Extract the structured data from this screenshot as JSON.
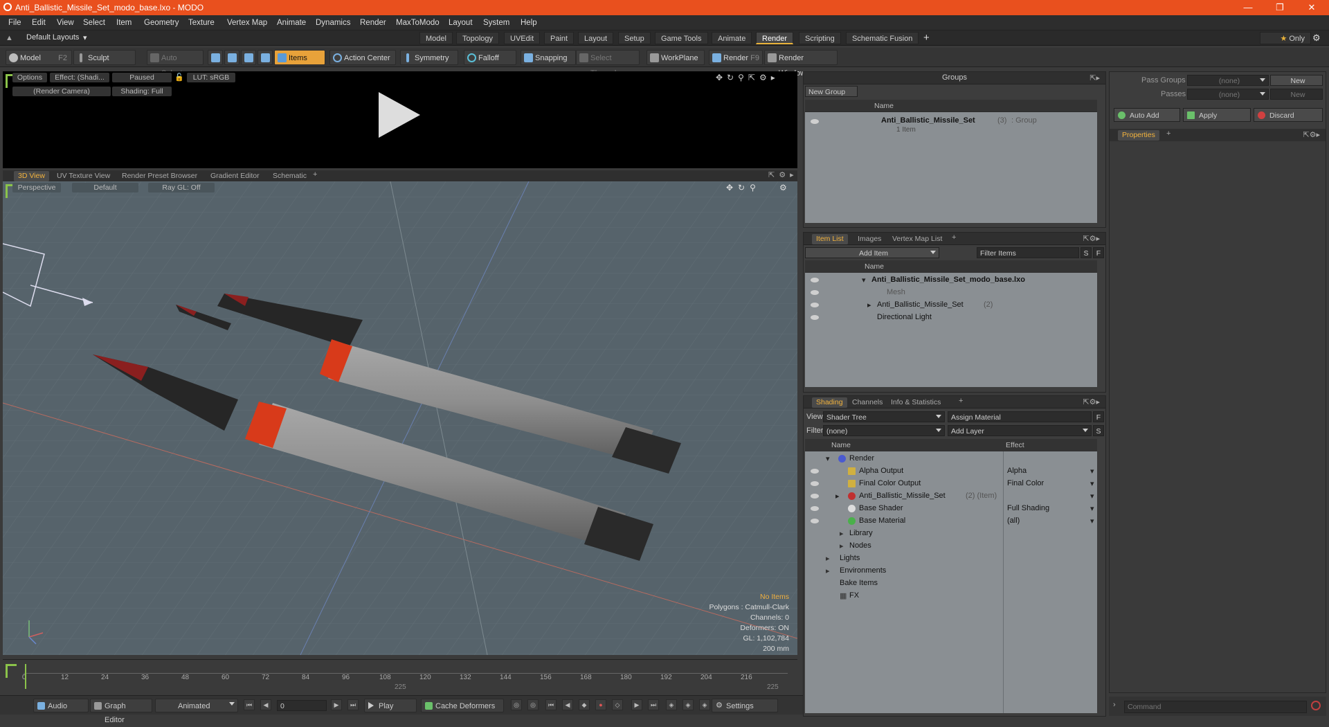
{
  "window": {
    "title": "Anti_Ballistic_Missile_Set_modo_base.lxo - MODO"
  },
  "menu": [
    "File",
    "Edit",
    "View",
    "Select",
    "Item",
    "Geometry",
    "Texture",
    "Vertex Map",
    "Animate",
    "Dynamics",
    "Render",
    "MaxToModo",
    "Layout",
    "System",
    "Help"
  ],
  "layouts": {
    "default": "Default Layouts",
    "tabs": [
      "Model",
      "Topology",
      "UVEdit",
      "Paint",
      "Layout",
      "Setup",
      "Game Tools",
      "Animate",
      "Render",
      "Scripting",
      "Schematic Fusion"
    ],
    "active": "Render",
    "only": "Only"
  },
  "toolbar": {
    "model": "Model",
    "model_key": "F2",
    "sculpt": "Sculpt",
    "auto_select": "Auto Select",
    "items": "Items",
    "action_center": "Action Center",
    "symmetry": "Symmetry",
    "falloff": "Falloff",
    "snapping": "Snapping",
    "select_through": "Select Through",
    "workplane": "WorkPlane",
    "render": "Render",
    "render_key": "F9",
    "render_window": "Render Window"
  },
  "render_view": {
    "options": "Options",
    "effect": "Effect: (Shadi...",
    "paused": "Paused",
    "lut": "LUT: sRGB",
    "camera": "(Render Camera)",
    "shading": "Shading: Full"
  },
  "view_tabs": [
    "3D View",
    "UV Texture View",
    "Render Preset Browser",
    "Gradient Editor",
    "Schematic"
  ],
  "viewport": {
    "projection": "Perspective",
    "style": "Default",
    "raygl": "Ray GL: Off",
    "info": {
      "no_items": "No Items",
      "polygons": "Polygons : Catmull-Clark",
      "channels": "Channels: 0",
      "deformers": "Deformers: ON",
      "gl": "GL: 1,102,784",
      "scale": "200 mm"
    }
  },
  "timeline": {
    "ticks": [
      "0",
      "12",
      "24",
      "36",
      "48",
      "60",
      "72",
      "84",
      "96",
      "108",
      "120",
      "132",
      "144",
      "156",
      "168",
      "180",
      "192",
      "204",
      "216"
    ],
    "sub_ticks": [
      "225",
      "225"
    ]
  },
  "transport": {
    "audio": "Audio",
    "graph_editor": "Graph Editor",
    "animated": "Animated",
    "frame": "0",
    "play": "Play",
    "cache": "Cache Deformers",
    "settings": "Settings"
  },
  "groups": {
    "title": "Groups",
    "new_group": "New Group",
    "col_name": "Name",
    "item_name": "Anti_Ballistic_Missile_Set",
    "item_count": "(3)",
    "item_type": ": Group",
    "item_sub": "1 Item"
  },
  "item_list": {
    "tabs": [
      "Item List",
      "Images",
      "Vertex Map List"
    ],
    "add_item": "Add Item",
    "filter": "Filter Items",
    "col_name": "Name",
    "rows": [
      {
        "name": "Anti_Ballistic_Missile_Set_modo_base.lxo",
        "count": ""
      },
      {
        "name": "Mesh",
        "count": ""
      },
      {
        "name": "Anti_Ballistic_Missile_Set",
        "count": "(2)"
      },
      {
        "name": "Directional Light",
        "count": ""
      }
    ]
  },
  "shading": {
    "tabs": [
      "Shading",
      "Channels",
      "Info & Statistics"
    ],
    "view_label": "View",
    "view_value": "Shader Tree",
    "assign": "Assign Material",
    "filter_label": "Filter",
    "filter_value": "(none)",
    "add_layer": "Add Layer",
    "col_name": "Name",
    "col_effect": "Effect",
    "rows": [
      {
        "name": "Render",
        "extra": "",
        "effect": ""
      },
      {
        "name": "Alpha Output",
        "extra": "",
        "effect": "Alpha"
      },
      {
        "name": "Final Color Output",
        "extra": "",
        "effect": "Final Color"
      },
      {
        "name": "Anti_Ballistic_Missile_Set",
        "extra": "(2) (Item)",
        "effect": ""
      },
      {
        "name": "Base Shader",
        "extra": "",
        "effect": "Full Shading"
      },
      {
        "name": "Base Material",
        "extra": "",
        "effect": "(all)"
      },
      {
        "name": "Library",
        "extra": "",
        "effect": ""
      },
      {
        "name": "Nodes",
        "extra": "",
        "effect": ""
      },
      {
        "name": "Lights",
        "extra": "",
        "effect": ""
      },
      {
        "name": "Environments",
        "extra": "",
        "effect": ""
      },
      {
        "name": "Bake Items",
        "extra": "",
        "effect": ""
      },
      {
        "name": "FX",
        "extra": "",
        "effect": ""
      }
    ]
  },
  "passes": {
    "pass_groups": "Pass Groups",
    "passes": "Passes",
    "none": "(none)",
    "new": "New",
    "auto_add": "Auto Add",
    "apply": "Apply",
    "discard": "Discard",
    "properties": "Properties"
  },
  "command": {
    "placeholder": "Command"
  }
}
